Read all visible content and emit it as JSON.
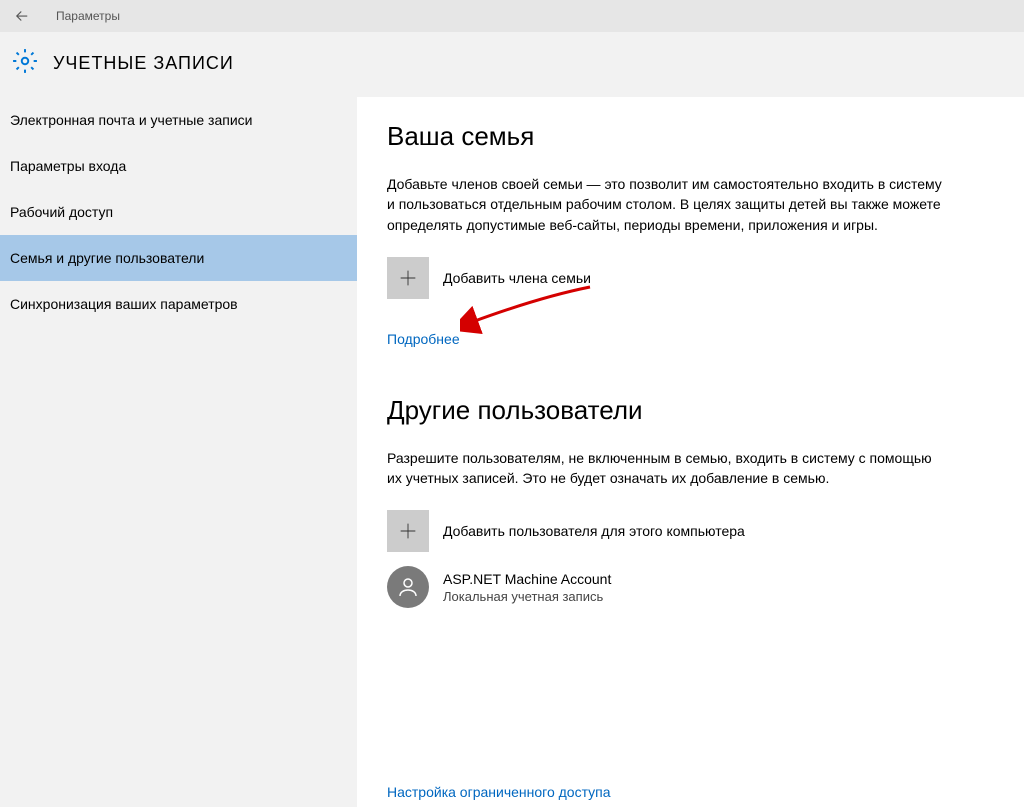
{
  "titlebar": {
    "window_title": "Параметры"
  },
  "header": {
    "page_title": "УЧЕТНЫЕ ЗАПИСИ"
  },
  "sidebar": {
    "items": [
      {
        "label": "Электронная почта и учетные записи"
      },
      {
        "label": "Параметры входа"
      },
      {
        "label": "Рабочий доступ"
      },
      {
        "label": "Семья и другие пользователи"
      },
      {
        "label": "Синхронизация ваших параметров"
      }
    ],
    "selected_index": 3
  },
  "main": {
    "family": {
      "title": "Ваша семья",
      "desc": "Добавьте членов своей семьи — это позволит им самостоятельно входить в систему и пользоваться отдельным рабочим столом. В целях защиты детей вы также можете определять допустимые веб-сайты, периоды времени, приложения и игры.",
      "add_label": "Добавить члена семьи",
      "more_link": "Подробнее"
    },
    "others": {
      "title": "Другие пользователи",
      "desc": "Разрешите пользователям, не включенным в семью, входить в систему с помощью их учетных записей. Это не будет означать их добавление в семью.",
      "add_label": "Добавить пользователя для этого компьютера",
      "user": {
        "name": "ASP.NET Machine Account",
        "type": "Локальная учетная запись"
      }
    },
    "restricted_link": "Настройка ограниченного доступа"
  }
}
